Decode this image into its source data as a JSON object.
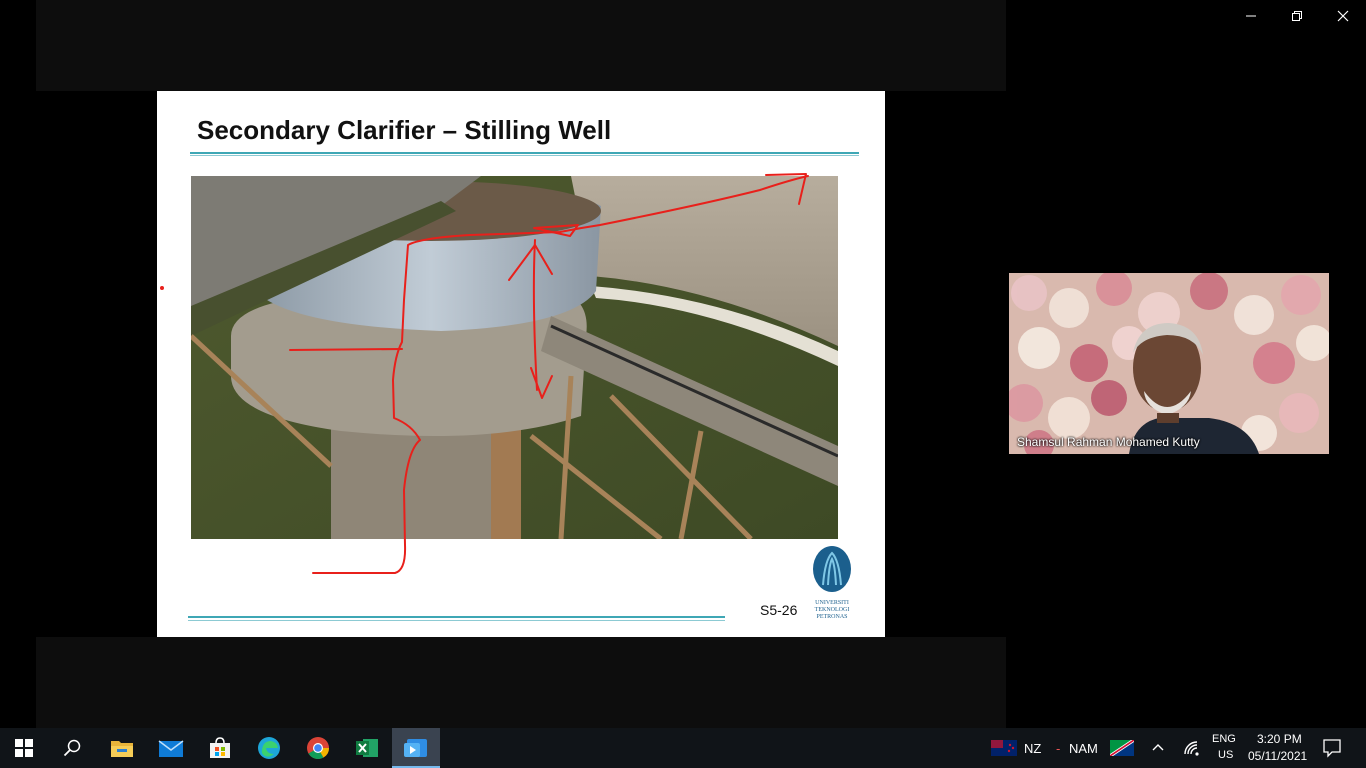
{
  "window": {
    "minimize_icon": "minimize-icon",
    "restore_icon": "restore-icon",
    "close_icon": "close-icon"
  },
  "slide": {
    "title": "Secondary Clarifier – Stilling Well",
    "number": "S5-26",
    "logo_lines": [
      "UNIVERSITI",
      "TEKNOLOGI",
      "PETRONAS"
    ],
    "accent_color": "#3fa7b5",
    "annotation_color": "#e8201b"
  },
  "participant": {
    "name": "Shamsul Rahman Mohamed Kutty"
  },
  "taskbar": {
    "apps": [
      "start-icon",
      "search-icon",
      "file-explorer-icon",
      "mail-icon",
      "store-icon",
      "edge-icon",
      "chrome-icon",
      "excel-icon",
      "video-app-icon"
    ],
    "tray": {
      "region_left": "NZ",
      "separator": "-",
      "region_right": "NAM",
      "lang_top": "ENG",
      "lang_bottom": "US",
      "time": "3:20 PM",
      "date": "05/11/2021"
    }
  }
}
